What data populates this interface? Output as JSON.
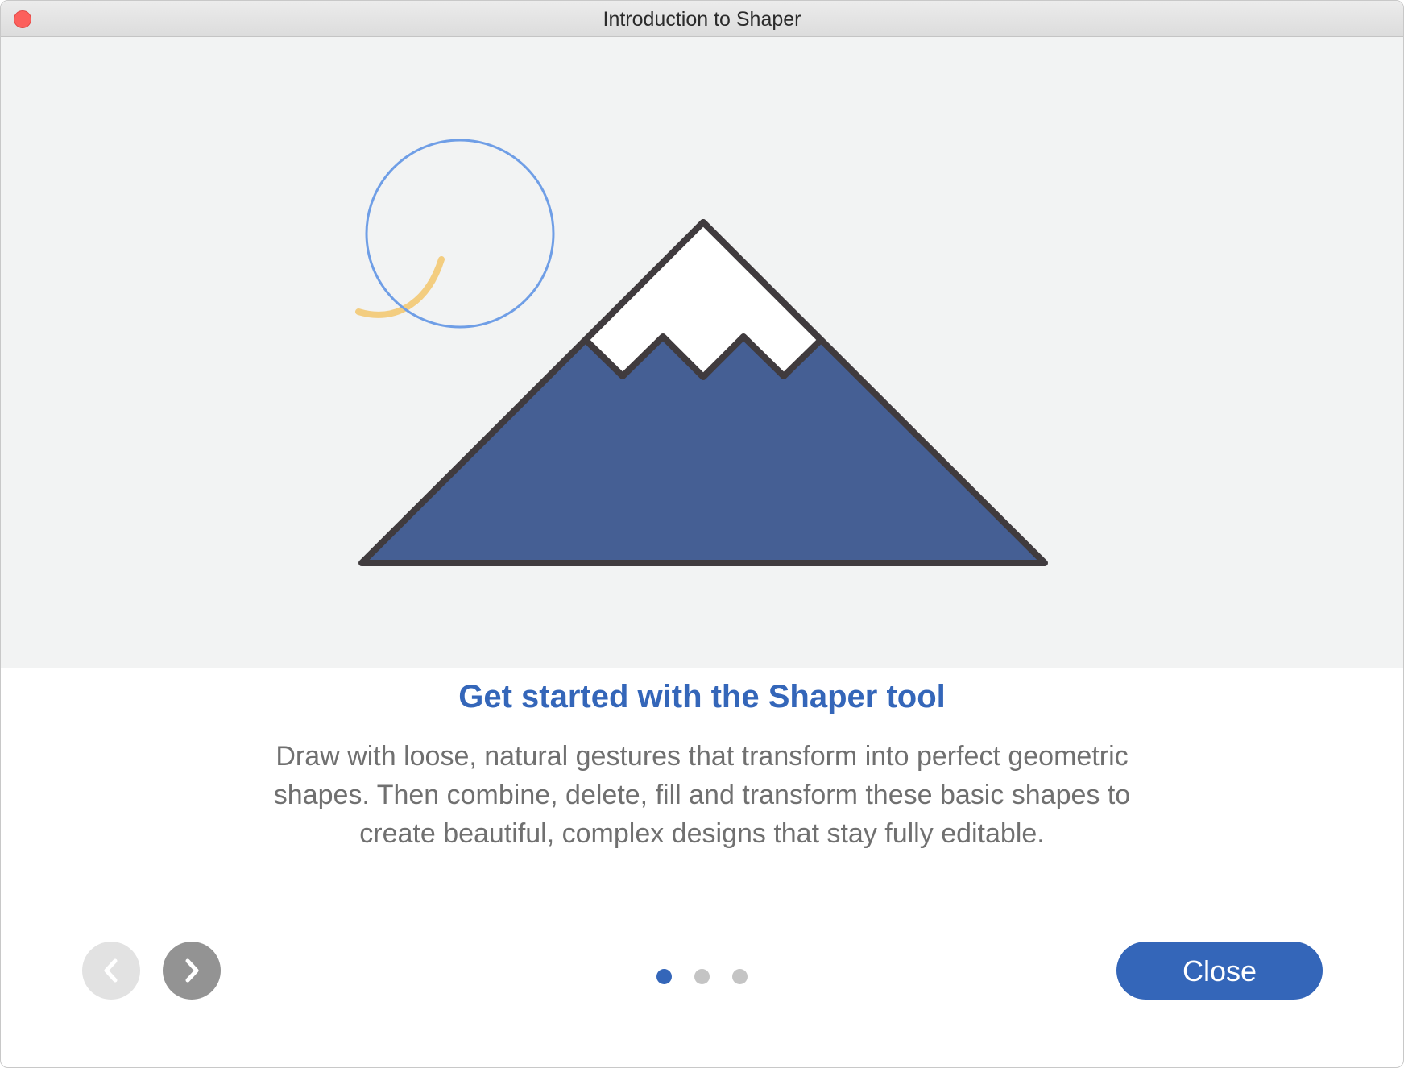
{
  "window": {
    "title": "Introduction to Shaper"
  },
  "content": {
    "heading": "Get started with the Shaper tool",
    "body": "Draw with loose, natural gestures that transform into perfect geometric shapes. Then combine, delete, fill and transform these basic shapes to create beautiful, complex designs that stay fully editable."
  },
  "navigation": {
    "prev_icon": "chevron-left-icon",
    "next_icon": "chevron-right-icon",
    "pages": {
      "current": 1,
      "total": 3
    }
  },
  "footer": {
    "close_label": "Close"
  },
  "colors": {
    "accent": "#3466b9",
    "mountain_fill": "#455f94",
    "outline": "#403b3e",
    "circle_stroke": "#6f9ee6",
    "arc_stroke": "#f3cd80",
    "hero_background": "#f2f3f3"
  }
}
